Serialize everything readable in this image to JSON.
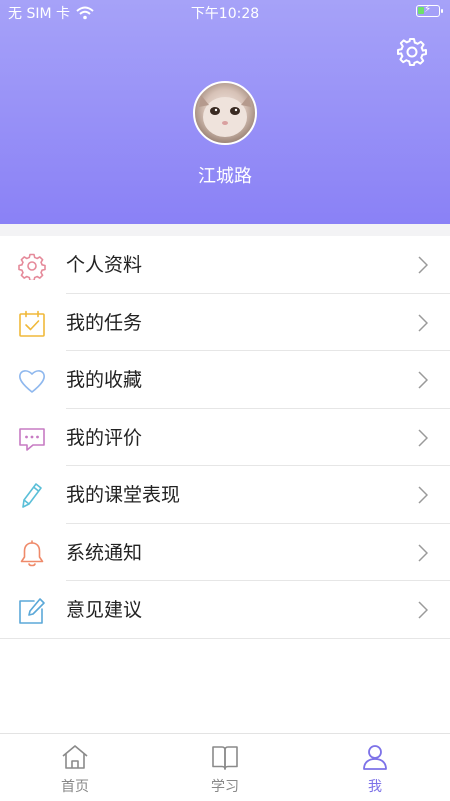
{
  "status_bar": {
    "carrier": "无 SIM 卡",
    "time": "下午10:28"
  },
  "profile": {
    "username": "江城路"
  },
  "menu": [
    {
      "label": "个人资料",
      "icon": "gear-icon",
      "color": "#e58a9a"
    },
    {
      "label": "我的任务",
      "icon": "calendar-check-icon",
      "color": "#f0b93a"
    },
    {
      "label": "我的收藏",
      "icon": "heart-icon",
      "color": "#8fb8ee"
    },
    {
      "label": "我的评价",
      "icon": "chat-bubble-icon",
      "color": "#c77bc3"
    },
    {
      "label": "我的课堂表现",
      "icon": "pencil-icon",
      "color": "#5bbfd8"
    },
    {
      "label": "系统通知",
      "icon": "bell-icon",
      "color": "#ef8a6a"
    },
    {
      "label": "意见建议",
      "icon": "edit-icon",
      "color": "#5ba8d8"
    }
  ],
  "tabbar": [
    {
      "label": "首页",
      "icon": "home-icon",
      "active": false
    },
    {
      "label": "学习",
      "icon": "book-icon",
      "active": false
    },
    {
      "label": "我",
      "icon": "person-icon",
      "active": true
    }
  ],
  "colors": {
    "header_gradient_top": "#a6a2f8",
    "header_gradient_bottom": "#8a81f6",
    "active_tab": "#7d72e8"
  }
}
